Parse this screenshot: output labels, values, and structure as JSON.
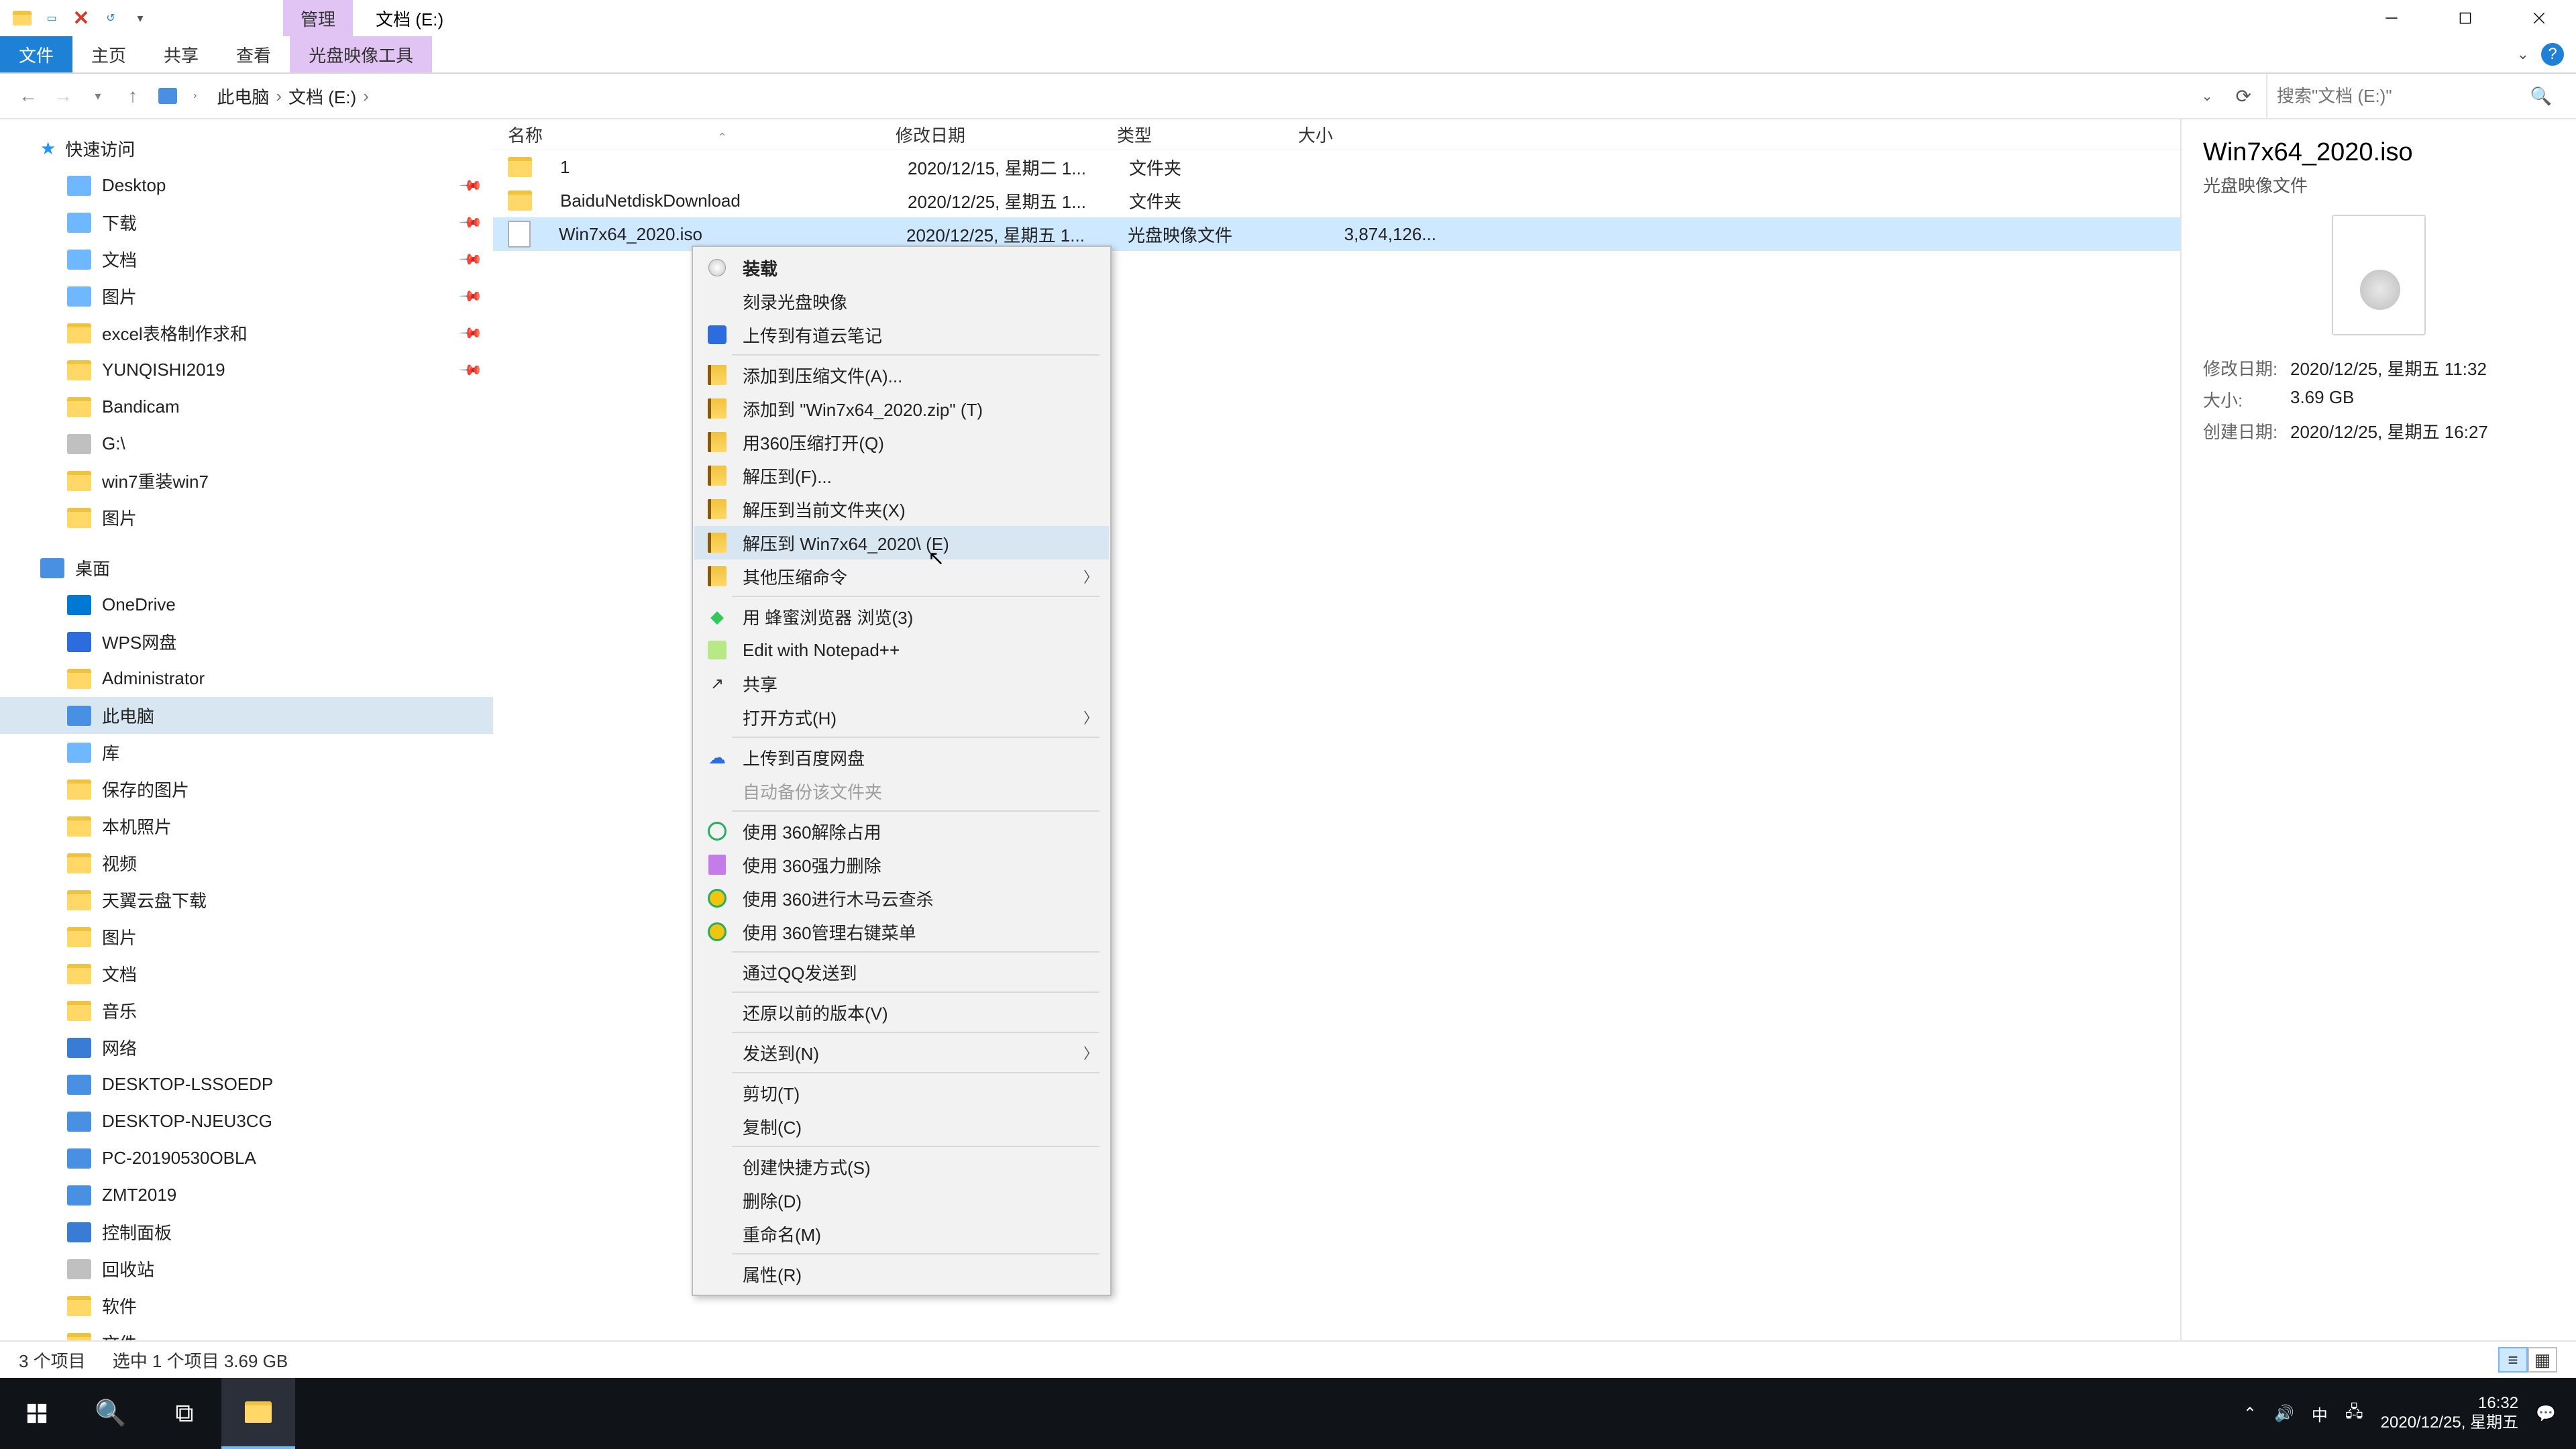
{
  "titlebar": {
    "context_tab": "管理",
    "window_title": "文档 (E:)"
  },
  "ribbon": {
    "file": "文件",
    "home": "主页",
    "share": "共享",
    "view": "查看",
    "disc_tools": "光盘映像工具"
  },
  "breadcrumb": {
    "root": "此电脑",
    "loc": "文档 (E:)"
  },
  "search": {
    "placeholder": "搜索\"文档 (E:)\""
  },
  "tree": {
    "quick": "快速访问",
    "items_quick": [
      "Desktop",
      "下载",
      "文档",
      "图片",
      "excel表格制作求和",
      "YUNQISHI2019",
      "Bandicam",
      "G:\\",
      "win7重装win7",
      "图片"
    ],
    "desktop": "桌面",
    "items_desktop": [
      "OneDrive",
      "WPS网盘",
      "Administrator",
      "此电脑",
      "库"
    ],
    "lib_items": [
      "保存的图片",
      "本机照片",
      "视频",
      "天翼云盘下载",
      "图片",
      "文档",
      "音乐"
    ],
    "network": "网络",
    "net_items": [
      "DESKTOP-LSSOEDP",
      "DESKTOP-NJEU3CG",
      "PC-20190530OBLA",
      "ZMT2019"
    ],
    "tail": [
      "控制面板",
      "回收站",
      "软件",
      "文件"
    ]
  },
  "columns": {
    "name": "名称",
    "date": "修改日期",
    "type": "类型",
    "size": "大小"
  },
  "rows": [
    {
      "name": "1",
      "date": "2020/12/15, 星期二 1...",
      "type": "文件夹",
      "size": ""
    },
    {
      "name": "BaiduNetdiskDownload",
      "date": "2020/12/25, 星期五 1...",
      "type": "文件夹",
      "size": ""
    },
    {
      "name": "Win7x64_2020.iso",
      "date": "2020/12/25, 星期五 1...",
      "type": "光盘映像文件",
      "size": "3,874,126..."
    }
  ],
  "preview": {
    "title": "Win7x64_2020.iso",
    "subtitle": "光盘映像文件",
    "labels": {
      "mod": "修改日期:",
      "size": "大小:",
      "created": "创建日期:"
    },
    "mod": "2020/12/25, 星期五 11:32",
    "size": "3.69 GB",
    "created": "2020/12/25, 星期五 16:27"
  },
  "status": {
    "count": "3 个项目",
    "sel": "选中 1 个项目  3.69 GB"
  },
  "ctx": {
    "mount": "装载",
    "burn": "刻录光盘映像",
    "upload_youdao": "上传到有道云笔记",
    "add_archive": "添加到压缩文件(A)...",
    "add_zip": "添加到 \"Win7x64_2020.zip\" (T)",
    "open_360zip": "用360压缩打开(Q)",
    "extract_to": "解压到(F)...",
    "extract_here": "解压到当前文件夹(X)",
    "extract_named": "解压到 Win7x64_2020\\ (E)",
    "other_archive": "其他压缩命令",
    "browse_bee": "用 蜂蜜浏览器 浏览(3)",
    "edit_npp": "Edit with Notepad++",
    "share": "共享",
    "open_with": "打开方式(H)",
    "upload_baidu": "上传到百度网盘",
    "auto_backup": "自动备份该文件夹",
    "unlock_360": "使用 360解除占用",
    "force_del_360": "使用 360强力删除",
    "scan_360": "使用 360进行木马云查杀",
    "manage_360": "使用 360管理右键菜单",
    "send_qq": "通过QQ发送到",
    "restore_prev": "还原以前的版本(V)",
    "send_to": "发送到(N)",
    "cut": "剪切(T)",
    "copy": "复制(C)",
    "shortcut": "创建快捷方式(S)",
    "delete": "删除(D)",
    "rename": "重命名(M)",
    "props": "属性(R)"
  },
  "taskbar": {
    "ime": "中",
    "time": "16:32",
    "date": "2020/12/25, 星期五"
  }
}
